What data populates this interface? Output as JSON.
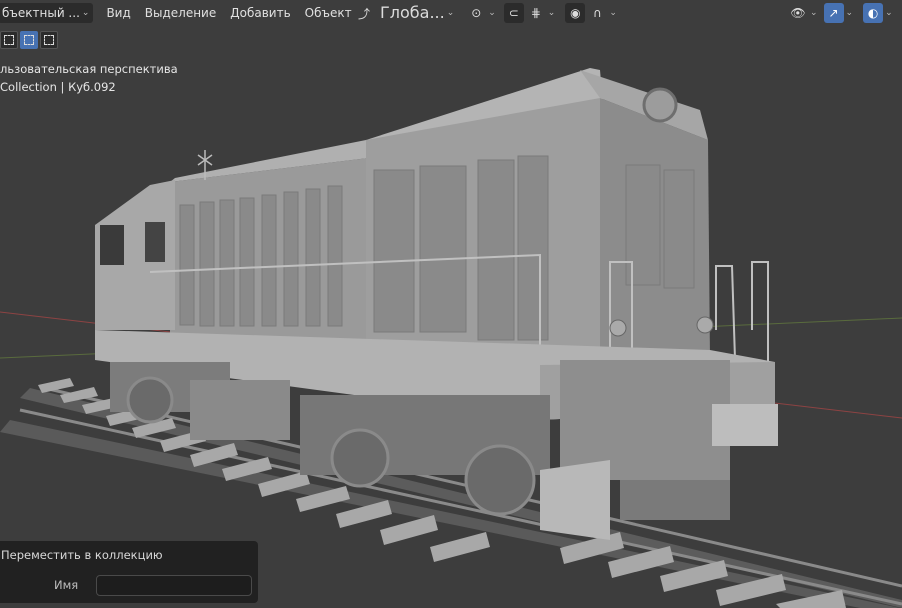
{
  "header": {
    "mode_label": "бъектный ...",
    "menu": [
      "Вид",
      "Выделение",
      "Добавить",
      "Объект"
    ],
    "orientation_label": "Глоба..."
  },
  "viewport": {
    "perspective_label": "льзовательская перспектива",
    "collection_label": "Collection | Куб.092"
  },
  "operator_panel": {
    "title": "Переместить в коллекцию",
    "name_label": "Имя",
    "name_value": ""
  },
  "icons": [
    "select-box-icon",
    "select-extend-icon",
    "select-subtract-icon",
    "transform-pivot-icon",
    "snap-icon",
    "snap-increment-icon",
    "proportional-edit-icon",
    "falloff-icon",
    "visibility-icon",
    "gizmo-icon",
    "overlay-icon"
  ],
  "colors": {
    "accent": "#4772b3",
    "viewport_bg": "#3d3d3d",
    "x_axis": "#b34a4a",
    "y_axis": "#6a8a3a"
  }
}
